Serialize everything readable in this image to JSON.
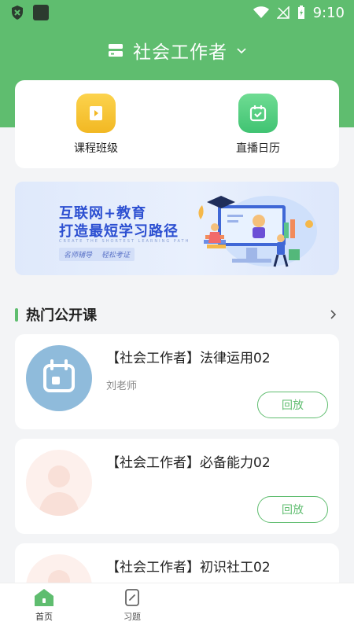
{
  "status_bar": {
    "time": "9:10"
  },
  "header": {
    "title": "社会工作者"
  },
  "quick_links": [
    {
      "label": "课程班级",
      "icon": "video-play-icon"
    },
    {
      "label": "直播日历",
      "icon": "calendar-check-icon"
    }
  ],
  "banner": {
    "line1": "互联网+教育",
    "line2": "打造最短学习路径",
    "subline": "CREATE THE SHORTEST LEARNING PATH",
    "tag1": "名师辅导",
    "tag2": "轻松考证"
  },
  "section": {
    "title": "热门公开课"
  },
  "courses": [
    {
      "title": "【社会工作者】法律运用02",
      "teacher": "刘老师",
      "button": "回放",
      "thumb_icon": "calendar-icon"
    },
    {
      "title": "【社会工作者】必备能力02",
      "teacher": "",
      "button": "回放",
      "thumb_icon": "person-placeholder-icon"
    },
    {
      "title": "【社会工作者】初识社工02",
      "teacher": "",
      "button": "",
      "thumb_icon": "person-placeholder-icon"
    }
  ],
  "tabs": [
    {
      "label": "首页",
      "icon": "home-icon",
      "active": true
    },
    {
      "label": "习题",
      "icon": "exercise-icon",
      "active": false
    }
  ],
  "colors": {
    "primary": "#5fbd6f",
    "background": "#f3f4f6"
  }
}
